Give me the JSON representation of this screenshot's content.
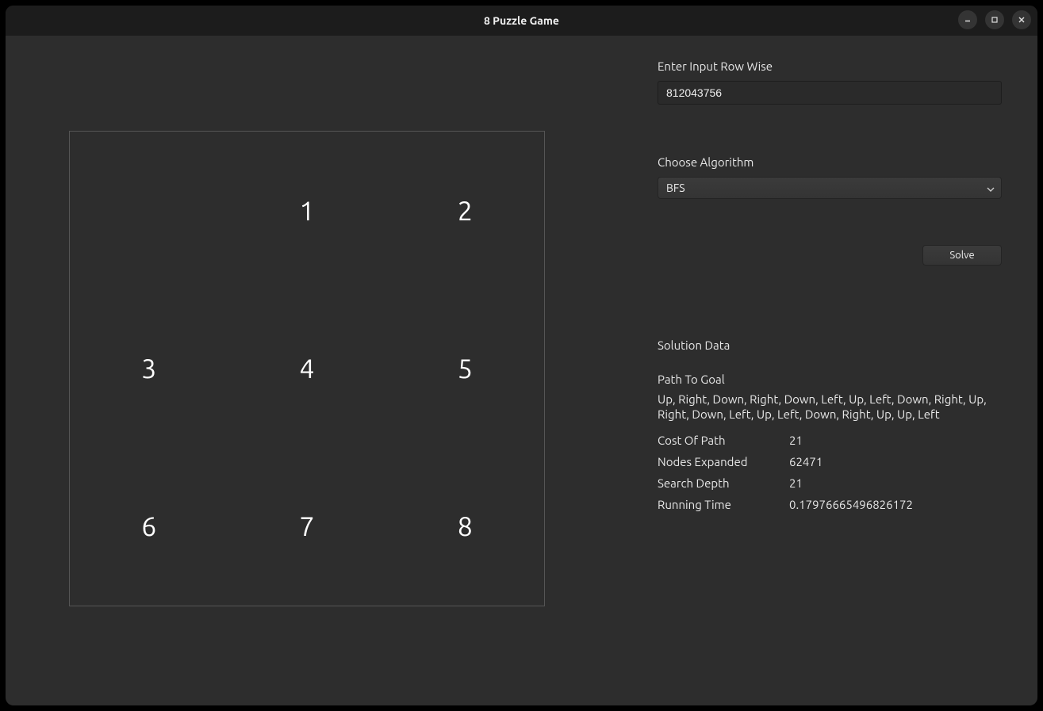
{
  "window": {
    "title": "8 Puzzle Game"
  },
  "board": {
    "tiles": [
      "",
      "1",
      "2",
      "3",
      "4",
      "5",
      "6",
      "7",
      "8"
    ]
  },
  "form": {
    "input_label": "Enter Input Row Wise",
    "input_value": "812043756",
    "algo_label": "Choose Algorithm",
    "algo_selected": "BFS",
    "solve_label": "Solve"
  },
  "solution": {
    "header": "Solution Data",
    "path_label": "Path To Goal",
    "path_value": "Up, Right, Down, Right, Down, Left, Up, Left, Down, Right, Up, Right, Down, Left, Up, Left, Down, Right, Up, Up, Left",
    "cost_label": "Cost Of Path",
    "cost_value": "21",
    "nodes_label": "Nodes Expanded",
    "nodes_value": "62471",
    "depth_label": "Search Depth",
    "depth_value": "21",
    "time_label": "Running Time",
    "time_value": "0.17976665496826172"
  }
}
